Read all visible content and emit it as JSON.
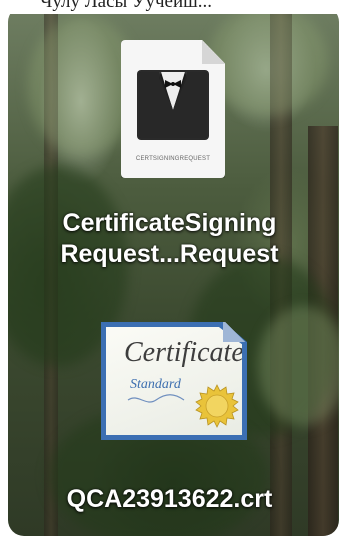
{
  "top_strip": {
    "partial_text": "Чулу Ласы Уучеиш..."
  },
  "desktop": {
    "icons": [
      {
        "kind": "certsigningrequest-file-icon",
        "file_type_label": "CERTSIGNINGREQUEST",
        "label_line1": "CertificateSigning",
        "label_line2": "Request...Request"
      },
      {
        "kind": "certificate-file-icon",
        "cert_title": "Certificate",
        "cert_subtitle": "Standard",
        "label": "QCA23913622.crt"
      }
    ]
  },
  "colors": {
    "label_text": "#ffffff",
    "cert_border": "#3c6fb3",
    "seal_gold": "#e9c33a"
  }
}
